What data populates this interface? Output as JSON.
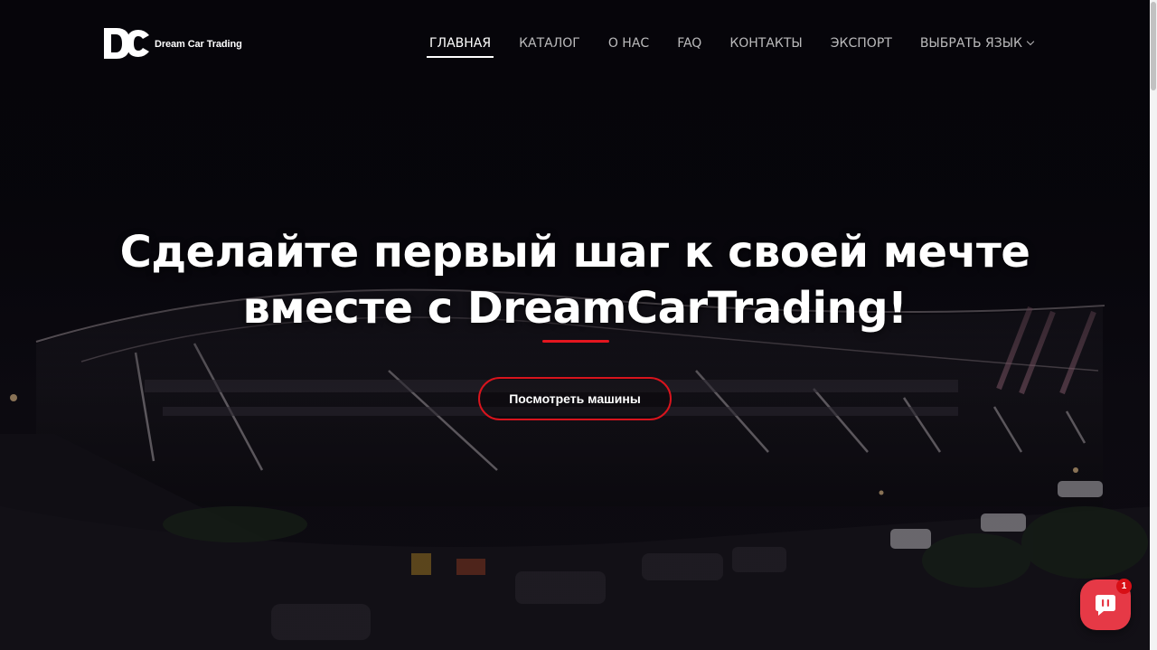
{
  "brand": {
    "logo_text": "Dream Car Trading",
    "accent_color": "#e4161f"
  },
  "nav": {
    "items": [
      {
        "label": "ГЛАВНАЯ",
        "active": true
      },
      {
        "label": "КАТАЛОГ",
        "active": false
      },
      {
        "label": "О НАС",
        "active": false
      },
      {
        "label": "FAQ",
        "active": false
      },
      {
        "label": "КОНТАКТЫ",
        "active": false
      },
      {
        "label": "ЭКСПОРТ",
        "active": false
      },
      {
        "label": "ВЫБРАТЬ ЯЗЫК",
        "active": false,
        "icon": "chevron-down-icon"
      }
    ]
  },
  "hero": {
    "headline_line1": "Сделайте первый шаг к своей мечте",
    "headline_line2": "вместе с DreamCarTrading!",
    "cta_label": "Посмотреть машины",
    "background": "night-building-photo"
  },
  "chat": {
    "icon": "chat-bubble-icon",
    "badge_count": "1"
  }
}
